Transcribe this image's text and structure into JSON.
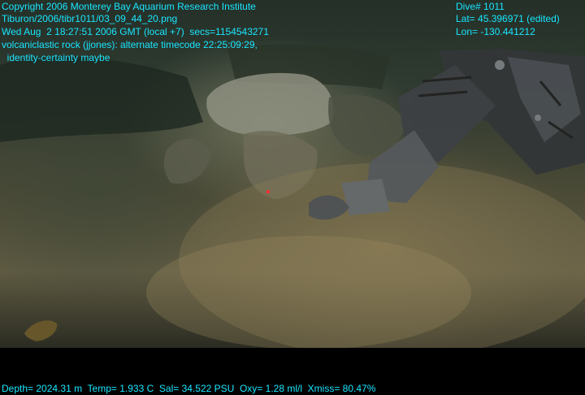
{
  "overlay": {
    "copyright": "Copyright 2006 Monterey Bay Aquarium Research Institute",
    "file": "Tiburon/2006/tibr1011/03_09_44_20.png",
    "datetime": "Wed Aug  2 18:27:51 2006 GMT (local +7)  secs=1154543271",
    "annotation": "volcaniclastic rock (jjones): alternate timecode 22:25:09:29,",
    "certainty": "  identity-certainty maybe",
    "dive": "Dive# 1011",
    "lat": "Lat= 45.396971 (edited)",
    "lon": "Lon= -130.441212",
    "telemetry": "Depth= 2024.31 m  Temp= 1.933 C  Sal= 34.522 PSU  Oxy= 1.28 ml/l  Xmiss= 80.47%"
  },
  "colors": {
    "overlay_text": "#19e6ff",
    "letterbox": "#000000"
  }
}
